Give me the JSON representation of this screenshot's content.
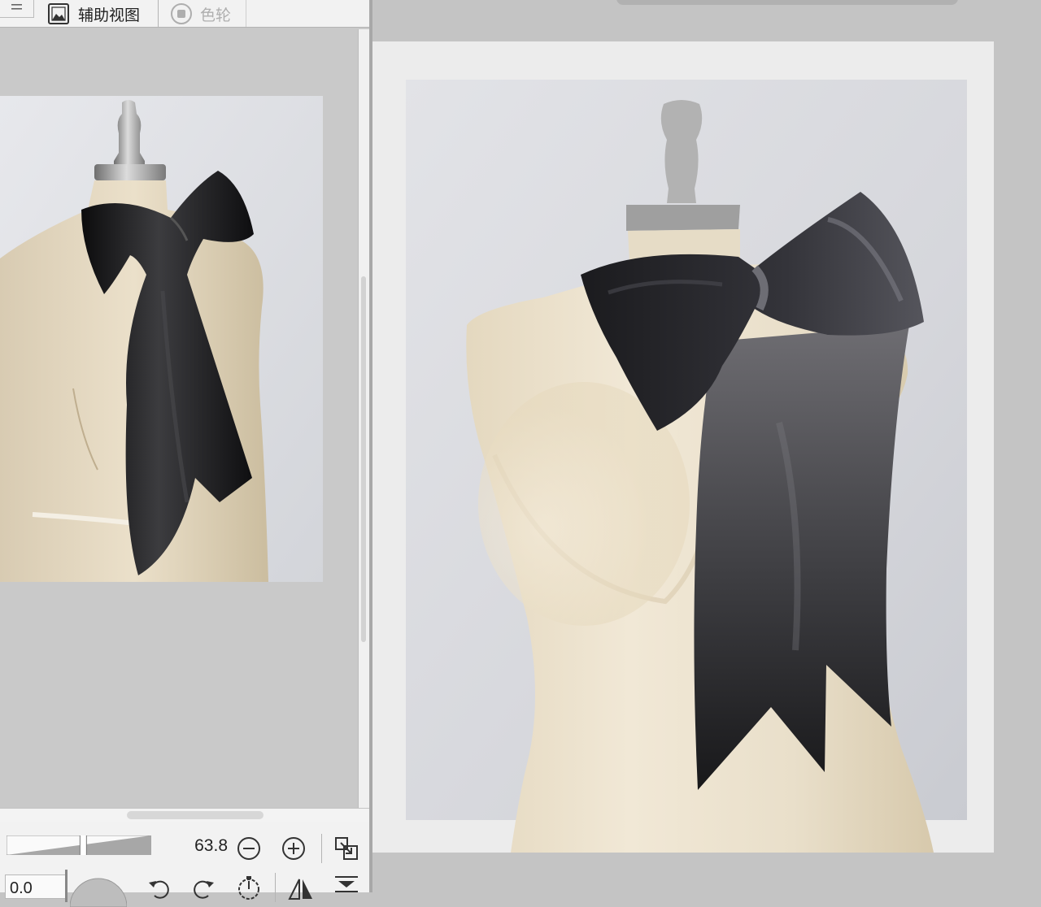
{
  "window": {
    "tabs": [
      {
        "label": "辅助视图",
        "icon": "navigator-picture-icon",
        "active": true
      },
      {
        "label": "色轮",
        "icon": "color-wheel-icon",
        "active": false
      }
    ]
  },
  "sub_view": {
    "zoom_value": "63.8",
    "zoom_slider_fraction": 0.53,
    "angle_value": "0.0",
    "controls": [
      "zoom-out-icon",
      "zoom-in-icon",
      "fit-to-view-icon",
      "rotate-left-icon",
      "rotate-right-icon",
      "reset-rotation-icon",
      "flip-horizontal-icon",
      "flip-vertical-icon"
    ]
  },
  "colors": {
    "panel_bg": "#c9c9c9",
    "tab_bg": "#f2f2f2",
    "canvas_bg": "#c4c4c4",
    "paper": "#ececec",
    "backdrop": "#dcdde1",
    "mannequin": "#ede3cf",
    "ribbon": "#1f1f22",
    "stand_metal": "#9a9a9a"
  }
}
